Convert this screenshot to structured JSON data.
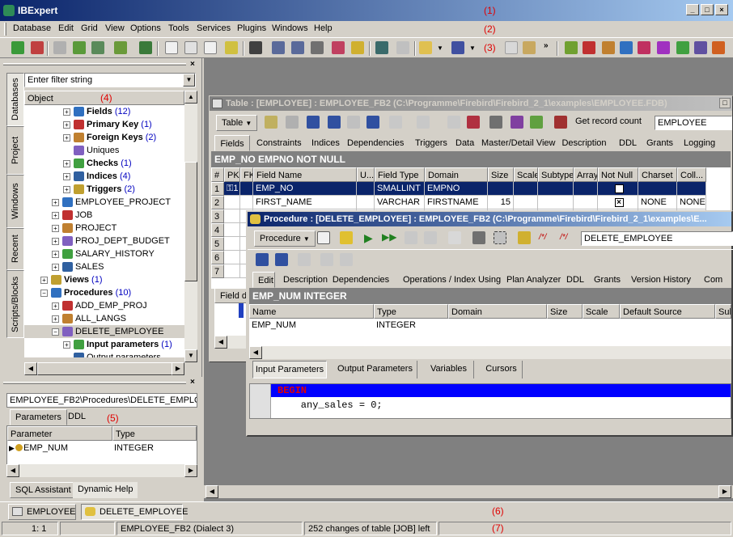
{
  "app": {
    "title": "IBExpert"
  },
  "annotations": {
    "a1": "(1)",
    "a2": "(2)",
    "a3": "(3)",
    "a4": "(4)",
    "a5": "(5)",
    "a6": "(6)",
    "a7": "(7)"
  },
  "menu": [
    "Database",
    "Edit",
    "Grid",
    "View",
    "Options",
    "Tools",
    "Services",
    "Plugins",
    "Windows",
    "Help"
  ],
  "db_explorer": {
    "filter_placeholder": "Enter filter string",
    "header": "Object",
    "side_tabs": [
      "Databases",
      "Project",
      "Windows",
      "Recent",
      "Scripts/Blocks"
    ],
    "tree": [
      {
        "label": "Fields",
        "count": "(12)",
        "bold": true,
        "indent": 2
      },
      {
        "label": "Primary Key",
        "count": "(1)",
        "bold": true,
        "indent": 2
      },
      {
        "label": "Foreign Keys",
        "count": "(2)",
        "bold": true,
        "indent": 2
      },
      {
        "label": "Uniques",
        "count": "",
        "bold": false,
        "indent": 2
      },
      {
        "label": "Checks",
        "count": "(1)",
        "bold": true,
        "indent": 2
      },
      {
        "label": "Indices",
        "count": "(4)",
        "bold": true,
        "indent": 2
      },
      {
        "label": "Triggers",
        "count": "(2)",
        "bold": true,
        "indent": 2
      },
      {
        "label": "EMPLOYEE_PROJECT",
        "count": "",
        "bold": false,
        "indent": 1
      },
      {
        "label": "JOB",
        "count": "",
        "bold": false,
        "indent": 1
      },
      {
        "label": "PROJECT",
        "count": "",
        "bold": false,
        "indent": 1
      },
      {
        "label": "PROJ_DEPT_BUDGET",
        "count": "",
        "bold": false,
        "indent": 1
      },
      {
        "label": "SALARY_HISTORY",
        "count": "",
        "bold": false,
        "indent": 1
      },
      {
        "label": "SALES",
        "count": "",
        "bold": false,
        "indent": 1
      },
      {
        "label": "Views",
        "count": "(1)",
        "bold": true,
        "indent": 0
      },
      {
        "label": "Procedures",
        "count": "(10)",
        "bold": true,
        "indent": 0
      },
      {
        "label": "ADD_EMP_PROJ",
        "count": "",
        "bold": false,
        "indent": 1
      },
      {
        "label": "ALL_LANGS",
        "count": "",
        "bold": false,
        "indent": 1
      },
      {
        "label": "DELETE_EMPLOYEE",
        "count": "",
        "bold": false,
        "indent": 1
      },
      {
        "label": "Input parameters",
        "count": "(1)",
        "bold": true,
        "indent": 2
      },
      {
        "label": "Output parameters",
        "count": "",
        "bold": false,
        "indent": 2
      }
    ]
  },
  "props_panel": {
    "path": "EMPLOYEE_FB2\\Procedures\\DELETE_EMPLO",
    "tabs": [
      "Parameters",
      "DDL"
    ],
    "columns": [
      "Parameter",
      "Type"
    ],
    "rows": [
      {
        "name": "EMP_NUM",
        "type": "INTEGER"
      }
    ],
    "bottom_tabs": [
      "SQL Assistant",
      "Dynamic Help"
    ]
  },
  "table_window": {
    "title": "Table : [EMPLOYEE] : EMPLOYEE_FB2 (C:\\Programme\\Firebird\\Firebird_2_1\\examples\\EMPLOYEE.FDB)",
    "table_btn": "Table",
    "get_count": "Get record count",
    "table_name": "EMPLOYEE",
    "tabs": [
      "Fields",
      "Constraints",
      "Indices",
      "Dependencies",
      "Triggers",
      "Data",
      "Master/Detail View",
      "Description",
      "DDL",
      "Grants",
      "Logging"
    ],
    "band": "EMP_NO EMPNO NOT NULL",
    "columns": [
      "#",
      "PK",
      "FK",
      "Field Name",
      "U...",
      "Field Type",
      "Domain",
      "Size",
      "Scale",
      "Subtype",
      "Array",
      "Not Null",
      "Charset",
      "Coll..."
    ],
    "rows": [
      {
        "n": "1",
        "name": "EMP_NO",
        "type": "SMALLINT",
        "domain": "EMPNO",
        "size": "",
        "charset": "",
        "coll": ""
      },
      {
        "n": "2",
        "name": "FIRST_NAME",
        "type": "VARCHAR",
        "domain": "FIRSTNAME",
        "size": "15",
        "charset": "NONE",
        "coll": "NONE"
      },
      {
        "n": "3"
      },
      {
        "n": "4"
      },
      {
        "n": "5"
      },
      {
        "n": "6"
      },
      {
        "n": "7"
      }
    ],
    "field_label": "Field d"
  },
  "proc_window": {
    "title": "Procedure : [DELETE_EMPLOYEE] : EMPLOYEE_FB2 (C:\\Programme\\Firebird\\Firebird_2_1\\examples\\E...",
    "proc_btn": "Procedure",
    "proc_name": "DELETE_EMPLOYEE",
    "tabs": [
      "Edit",
      "Description",
      "Dependencies",
      "Operations / Index Using",
      "Plan Analyzer",
      "DDL",
      "Grants",
      "Version History",
      "Com"
    ],
    "band": "EMP_NUM INTEGER",
    "columns": [
      "Name",
      "Type",
      "Domain",
      "Size",
      "Scale",
      "Default Source",
      "Sub"
    ],
    "rows": [
      {
        "name": "EMP_NUM",
        "type": "INTEGER"
      }
    ],
    "param_tabs": [
      "Input Parameters",
      "Output Parameters",
      "Variables",
      "Cursors"
    ],
    "code": [
      "BEGIN",
      "    any_sales = 0;"
    ]
  },
  "taskbar": [
    "EMPLOYEE",
    "DELETE_EMPLOYEE"
  ],
  "status": {
    "pos": "1:    1",
    "db": "EMPLOYEE_FB2 (Dialect 3)",
    "msg": "252 changes of table [JOB] left"
  }
}
